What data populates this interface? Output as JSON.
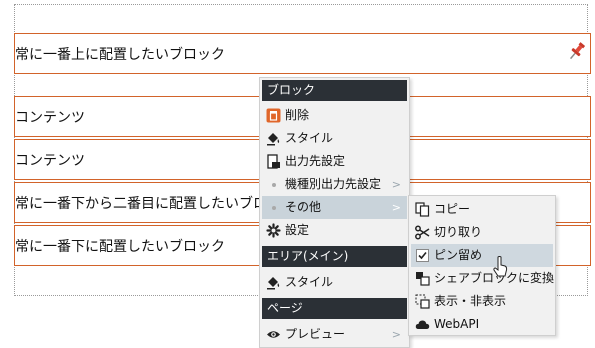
{
  "blocks": [
    {
      "label": "常に一番上に配置したいブロック"
    },
    {
      "label": "コンテンツ"
    },
    {
      "label": "コンテンツ"
    },
    {
      "label": "常に一番下から二番目に配置したいブロック"
    },
    {
      "label": "常に一番下に配置したいブロック"
    }
  ],
  "menu": {
    "block_header": "ブロック",
    "delete": "削除",
    "style": "スタイル",
    "output_dest": "出力先設定",
    "device_output": "機種別出力先設定",
    "other": "その他",
    "settings": "設定",
    "area_header": "エリア(メイン)",
    "area_style": "スタイル",
    "page_header": "ページ",
    "preview": "プレビュー",
    "submenu_arrow": ">"
  },
  "submenu": {
    "copy": "コピー",
    "cut": "切り取り",
    "pin": "ピン留め",
    "share_convert": "シェアブロックに変換",
    "show_hide": "表示・非表示",
    "webapi": "WebAPI"
  },
  "colors": {
    "block_border": "#d2632a",
    "menu_header_bg": "#2b3036",
    "highlight_bg": "#c9d3da",
    "delete_icon": "#e0662a"
  }
}
